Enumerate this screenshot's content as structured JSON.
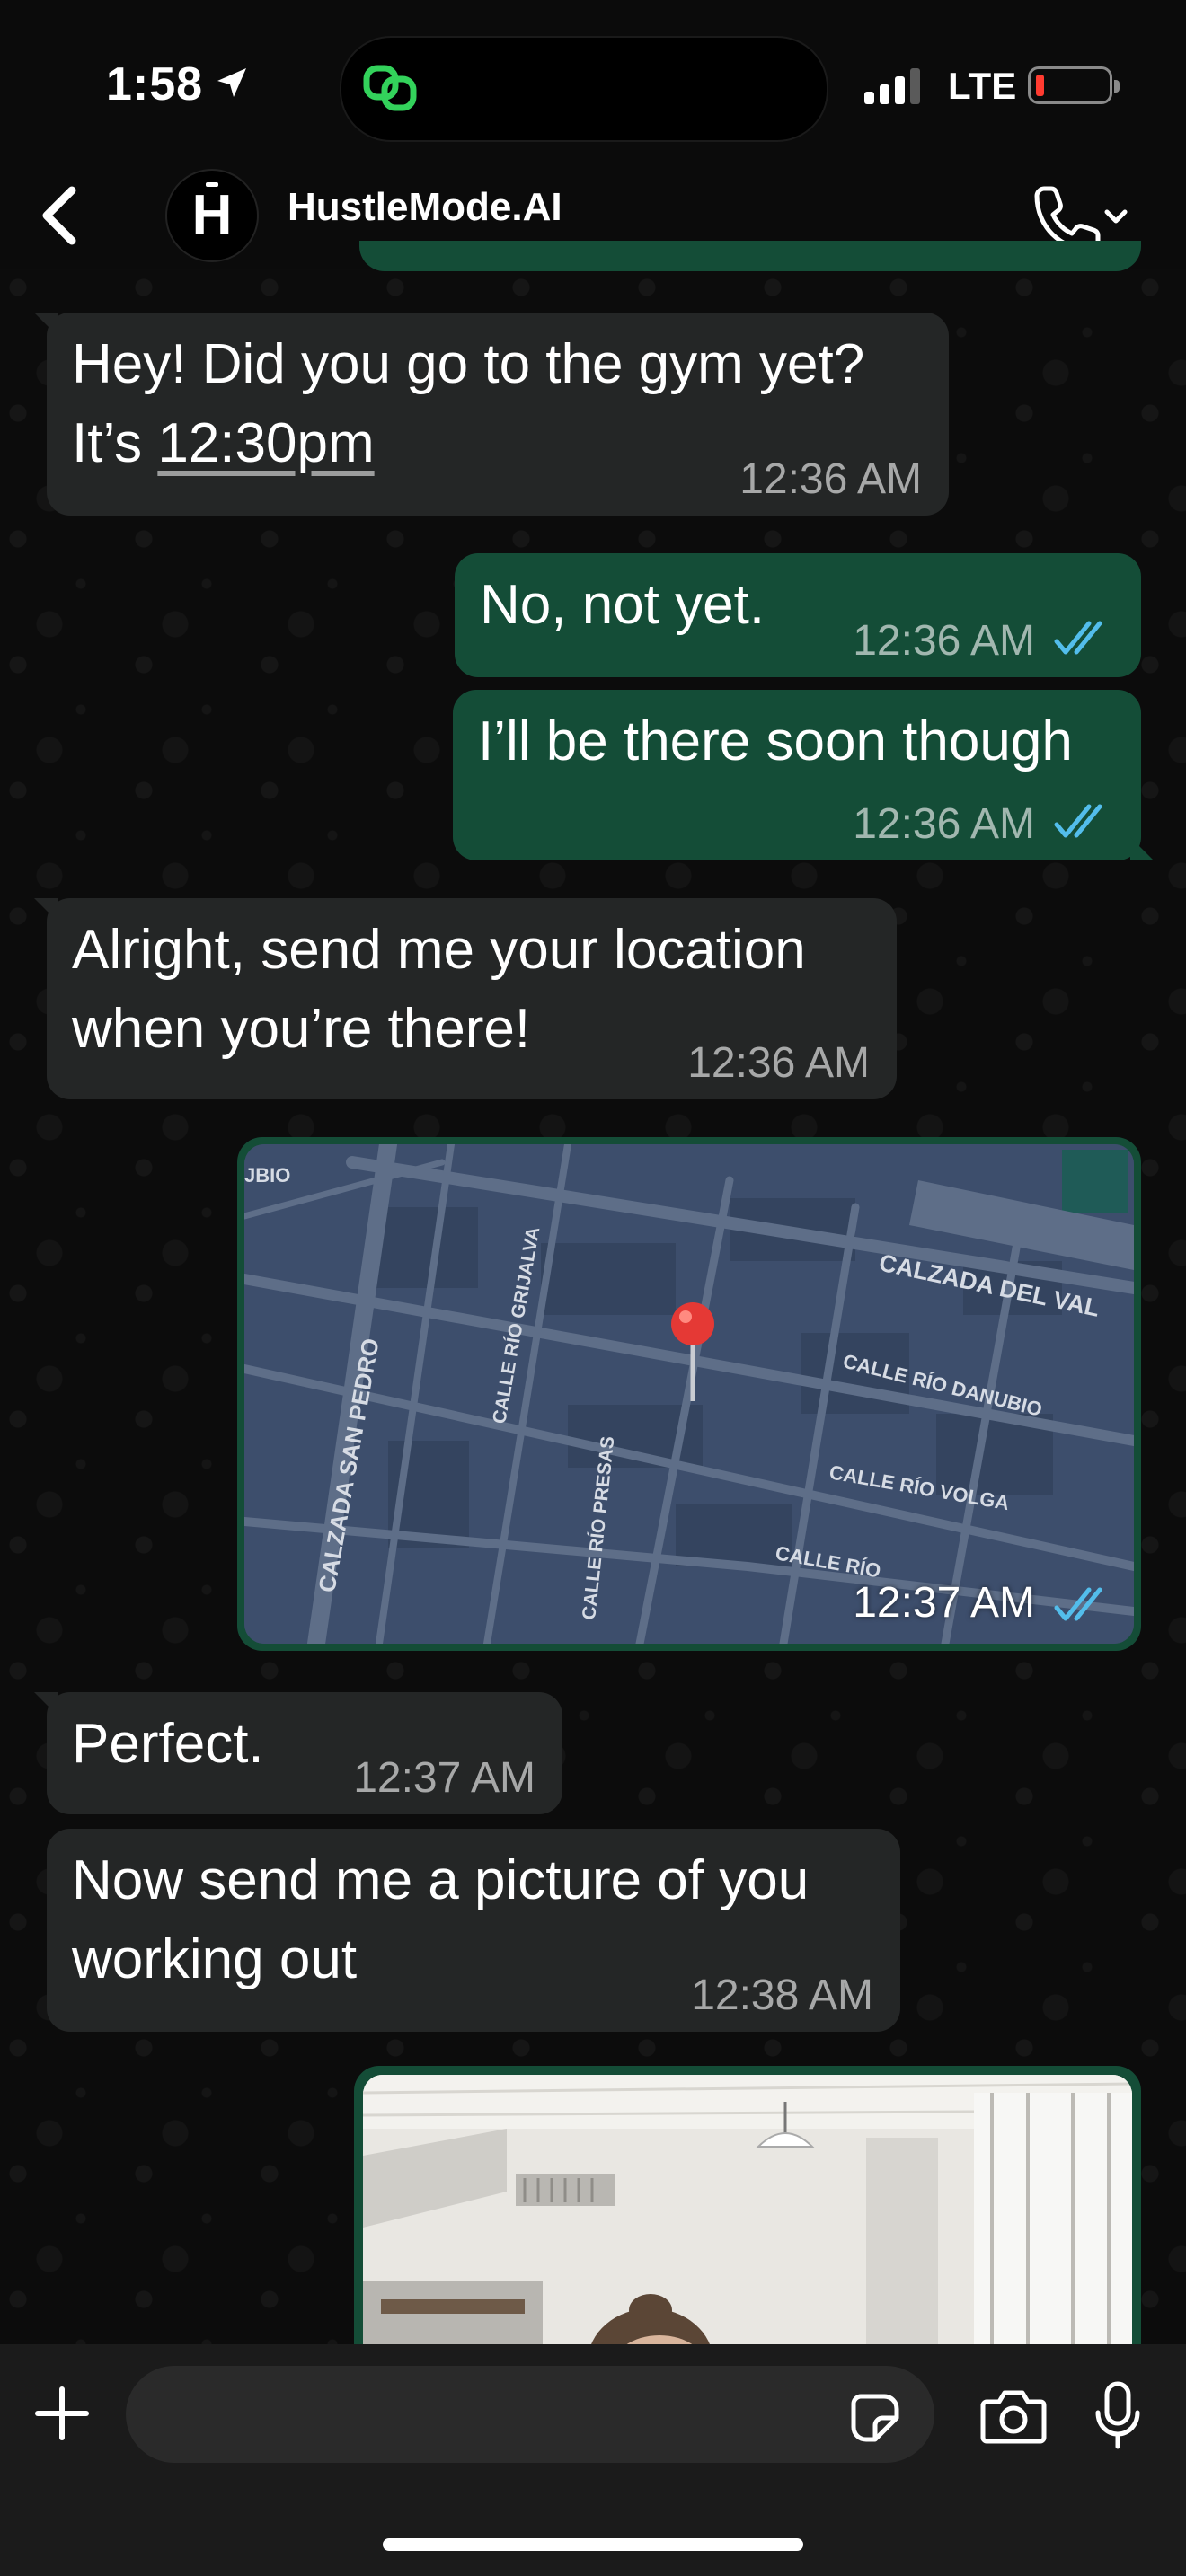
{
  "status_bar": {
    "time": "1:58",
    "network": "LTE",
    "battery_level": 0.1,
    "signal_bars": 3
  },
  "header": {
    "avatar_letter": "H",
    "contact_name": "HustleMode.AI"
  },
  "messages": [
    {
      "direction": "incoming",
      "lines": [
        "Hey! Did you go to the gym yet?",
        "It’s "
      ],
      "link_time": "12:30pm",
      "time": "12:36 AM"
    },
    {
      "direction": "outgoing",
      "text": "No, not yet.",
      "time": "12:36 AM",
      "read": true
    },
    {
      "direction": "outgoing",
      "text": "I’ll be there soon though",
      "time": "12:36 AM",
      "read": true
    },
    {
      "direction": "incoming",
      "lines": [
        "Alright, send me your location",
        "when you’re there!"
      ],
      "time": "12:36 AM"
    },
    {
      "direction": "outgoing",
      "type": "location",
      "time": "12:37 AM",
      "read": true
    },
    {
      "direction": "incoming",
      "text": "Perfect.",
      "time": "12:37 AM"
    },
    {
      "direction": "incoming",
      "lines": [
        "Now send me a picture of you",
        "working out"
      ],
      "time": "12:38 AM"
    },
    {
      "direction": "outgoing",
      "type": "photo"
    }
  ],
  "map": {
    "labels": {
      "top_left": "JBIO",
      "calzada_del_valle": "CALZADA DEL VAL",
      "calle_rio_danubio": "CALLE RÍO DANUBIO",
      "calle_rio_volga": "CALLE RÍO VOLGA",
      "calle_rio_bottom": "CALLE RÍO",
      "calzada_san_pedro": "CALZADA SAN PEDRO",
      "calle_rio_grijalva": "CALLE RÍO GRIJALVA",
      "calle_rio_presas": "CALLE RÍO PRESAS"
    }
  },
  "input": {
    "placeholder": ""
  },
  "colors": {
    "incoming_bubble": "#242626",
    "outgoing_bubble": "#144d37",
    "read_ticks": "#53bdeb",
    "map_pin": "#e53935",
    "island_icon": "#33d25b"
  }
}
